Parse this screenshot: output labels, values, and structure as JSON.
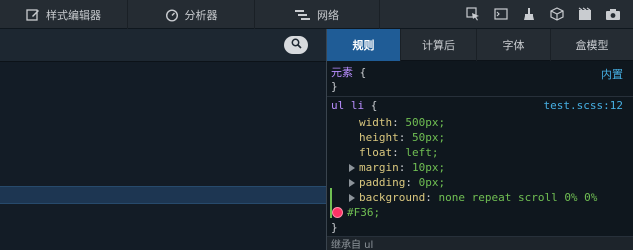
{
  "toolbar": {
    "tabs": [
      {
        "label": "样式编辑器",
        "icon": "edit-icon"
      },
      {
        "label": "分析器",
        "icon": "stopwatch-icon"
      },
      {
        "label": "网络",
        "icon": "network-icon"
      }
    ],
    "icons": [
      "pick-element-icon",
      "console-icon",
      "paintbrush-icon",
      "3d-box-icon",
      "scratchpad-icon",
      "screenshot-icon"
    ]
  },
  "left": {
    "search_icon": "search-icon"
  },
  "side_panel": {
    "tabs": [
      "规则",
      "计算后",
      "字体",
      "盒模型"
    ],
    "active_tab": "规则"
  },
  "rules": {
    "element": {
      "selector": "元素",
      "open": "{",
      "close": "}",
      "source": "内置"
    },
    "rule1": {
      "selector": "ul li",
      "open": "{",
      "close": "}",
      "source": "test.scss:12",
      "declarations": [
        {
          "prop": "width",
          "value": "500px;"
        },
        {
          "prop": "height",
          "value": "50px;"
        },
        {
          "prop": "float",
          "value": "left;"
        },
        {
          "prop": "margin",
          "value": "10px;"
        },
        {
          "prop": "padding",
          "value": "0px;"
        },
        {
          "prop": "background",
          "value": "none repeat scroll 0% 0%"
        }
      ],
      "color_value": "#F36;",
      "swatch_color": "#ff3366"
    },
    "inherited_label": "继承自 ul"
  }
}
